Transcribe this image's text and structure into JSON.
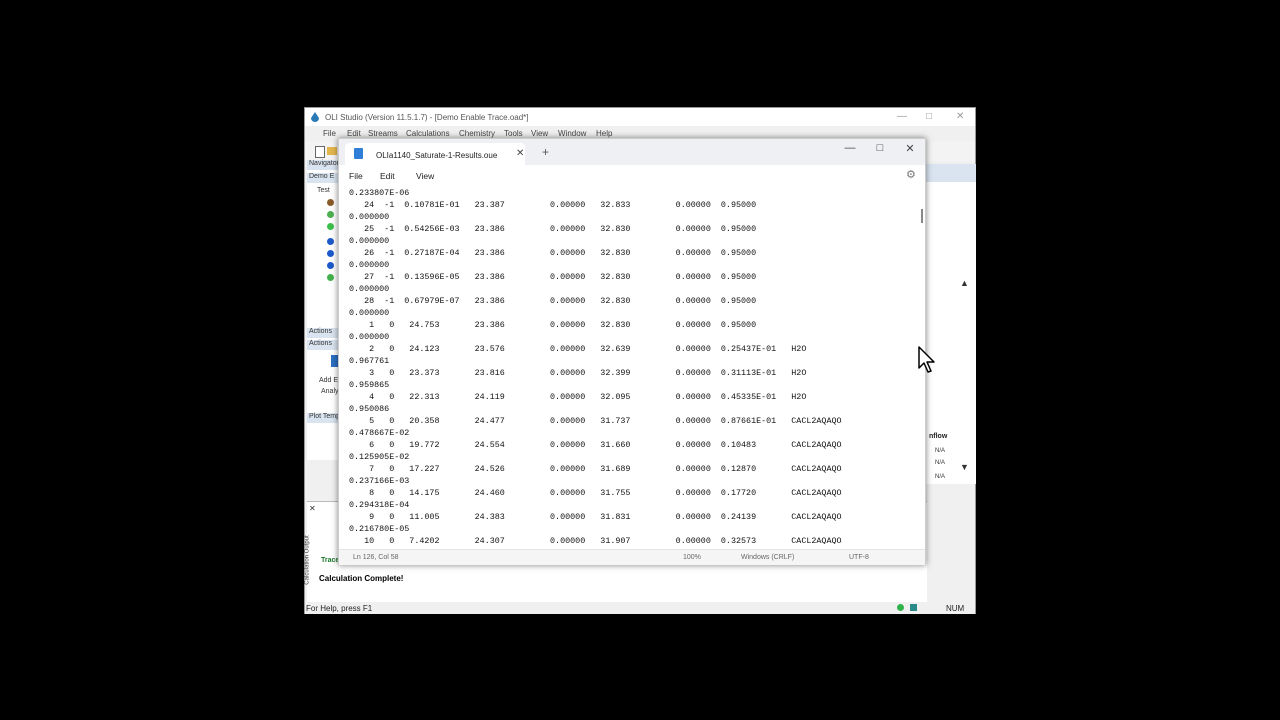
{
  "oli": {
    "title": "OLI Studio (Version 11.5.1.7) - [Demo Enable Trace.oad*]",
    "menu": [
      "File",
      "Edit",
      "Streams",
      "Calculations",
      "Chemistry",
      "Tools",
      "View",
      "Window",
      "Help"
    ],
    "navigator_label": "Navigator",
    "demo_label": "Demo E",
    "tree_root": "Test",
    "actions_label": "Actions",
    "actions_label_2": "Actions",
    "add_label": "Add E",
    "add_label_2": "Analy",
    "plot_label": "Plot Temp",
    "trace_label": "Trace",
    "output_side_label": "Calculation Output",
    "calc_complete": "Calculation Complete!",
    "right_partial_label": "nflow",
    "right_partial_values": [
      "N/A",
      "N/A",
      "N/A"
    ],
    "status_help": "For Help, press F1",
    "status_num": "NUM"
  },
  "notepad": {
    "tab_title": "OLIa1140_Saturate-1-Results.oue",
    "menu": {
      "file": "File",
      "edit": "Edit",
      "view": "View"
    },
    "lines": [
      "0.233807E-06",
      "   24  -1  0.10781E-01   23.387         0.00000   32.833         0.00000  0.95000",
      "0.000000",
      "   25  -1  0.54256E-03   23.386         0.00000   32.830         0.00000  0.95000",
      "0.000000",
      "   26  -1  0.27187E-04   23.386         0.00000   32.830         0.00000  0.95000",
      "0.000000",
      "   27  -1  0.13596E-05   23.386         0.00000   32.830         0.00000  0.95000",
      "0.000000",
      "   28  -1  0.67979E-07   23.386         0.00000   32.830         0.00000  0.95000",
      "0.000000",
      "    1   0   24.753       23.386         0.00000   32.830         0.00000  0.95000",
      "0.000000",
      "    2   0   24.123       23.576         0.00000   32.639         0.00000  0.25437E-01   H2O",
      "0.967761",
      "    3   0   23.373       23.816         0.00000   32.399         0.00000  0.31113E-01   H2O",
      "0.959865",
      "    4   0   22.313       24.119         0.00000   32.095         0.00000  0.45335E-01   H2O",
      "0.950086",
      "    5   0   20.358       24.477         0.00000   31.737         0.00000  0.87661E-01   CACL2AQAQO",
      "0.478667E-02",
      "    6   0   19.772       24.554         0.00000   31.660         0.00000  0.10483       CACL2AQAQO",
      "0.125905E-02",
      "    7   0   17.227       24.526         0.00000   31.689         0.00000  0.12870       CACL2AQAQO",
      "0.237166E-03",
      "    8   0   14.175       24.460         0.00000   31.755         0.00000  0.17720       CACL2AQAQO",
      "0.294318E-04",
      "    9   0   11.005       24.383         0.00000   31.831         0.00000  0.24139       CACL2AQAQO",
      "0.216780E-05",
      "   10   0   7.4202       24.307         0.00000   31.907         0.00000  0.32573       CACL2AQAQO"
    ],
    "status": {
      "position": "Ln 126, Col 58",
      "zoom": "100%",
      "line_ending": "Windows (CRLF)",
      "encoding": "UTF-8"
    }
  }
}
